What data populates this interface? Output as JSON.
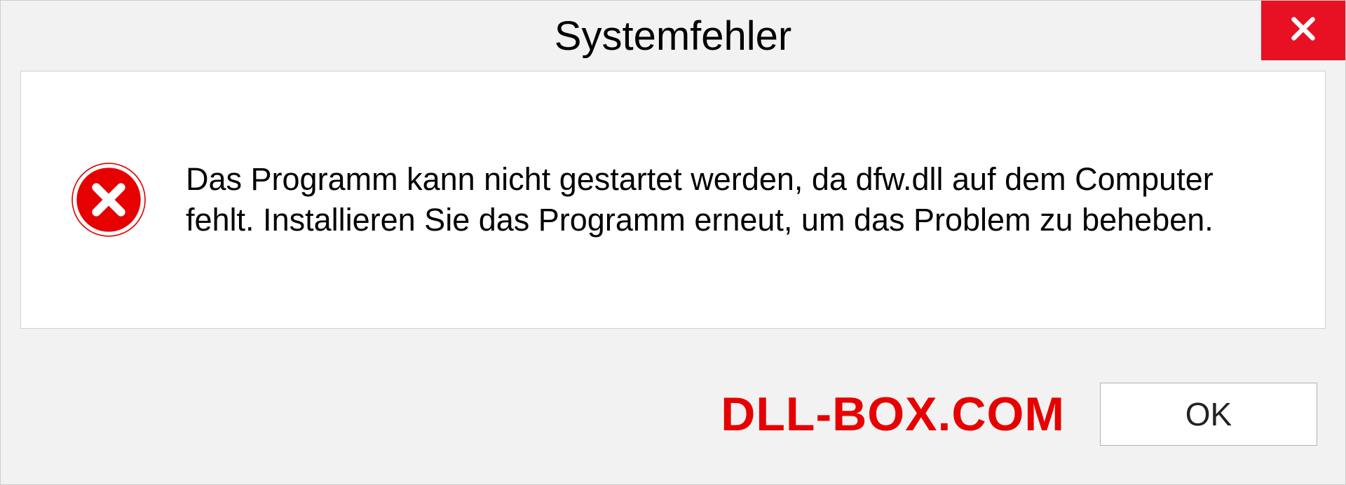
{
  "dialog": {
    "title": "Systemfehler",
    "message": "Das Programm kann nicht gestartet werden, da dfw.dll auf dem Computer fehlt. Installieren Sie das Programm erneut, um das Problem zu beheben.",
    "ok_label": "OK"
  },
  "watermark": "DLL-BOX.COM",
  "colors": {
    "close_button_bg": "#e81123",
    "error_icon": "#e60000",
    "watermark": "#e60000"
  }
}
